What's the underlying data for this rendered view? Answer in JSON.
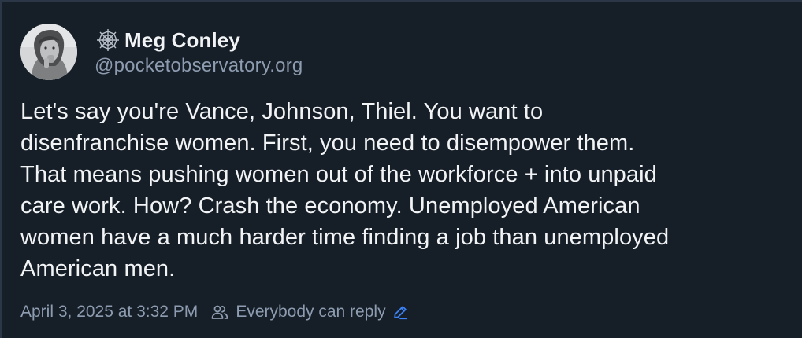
{
  "post": {
    "author": {
      "display_name": "Meg Conley",
      "handle": "@pocketobservatory.org",
      "name_icon": "spider-web-icon",
      "avatar": "avatar"
    },
    "text": "Let's say you're Vance, Johnson, Thiel. You want to\ndisenfranchise women. First, you need to disempower them.\nThat means pushing women out of the workforce + into unpaid\ncare work. How? Crash the economy. Unemployed American\nwomen have a much harder time finding a job than unemployed\nAmerican men.",
    "timestamp": "April 3, 2025 at 3:32 PM",
    "reply_setting": {
      "label": "Everybody can reply",
      "icon": "people-icon",
      "edit_icon": "pencil-icon"
    }
  },
  "colors": {
    "background": "#161e27",
    "text": "#f1f3f5",
    "muted": "#8d9cb0",
    "accent": "#3b82f6"
  }
}
